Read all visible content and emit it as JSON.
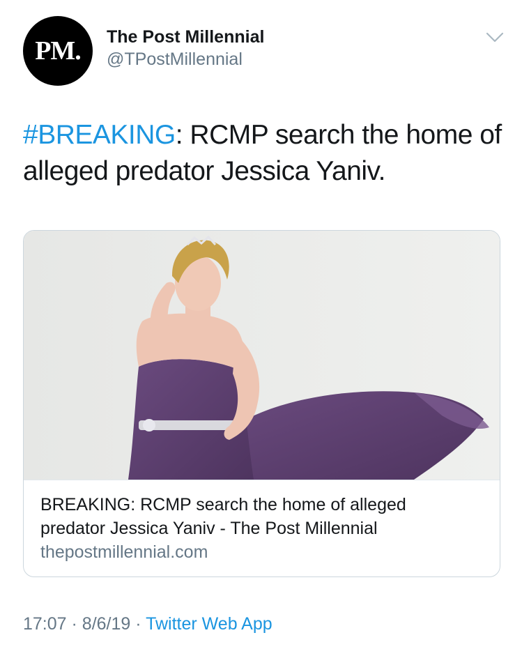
{
  "account": {
    "avatar_text": "PM.",
    "display_name": "The Post Millennial",
    "handle": "@TPostMillennial"
  },
  "tweet": {
    "hashtag": "#BREAKING",
    "text_rest": ": RCMP search the home of alleged predator Jessica Yaniv."
  },
  "card": {
    "title_line1": "BREAKING: RCMP search the home of alleged",
    "title_line2": "predator Jessica Yaniv - The Post Millennial",
    "domain": "thepostmillennial.com"
  },
  "meta": {
    "time": "17:07",
    "sep1": "·",
    "date": "8/6/19",
    "sep2": "·",
    "source": "Twitter Web App"
  },
  "colors": {
    "link": "#1b95e0",
    "secondary_text": "#657786",
    "card_border": "#ccd6dd",
    "dress": "#5a3d6e"
  },
  "icons": [
    "chevron-down-icon"
  ]
}
